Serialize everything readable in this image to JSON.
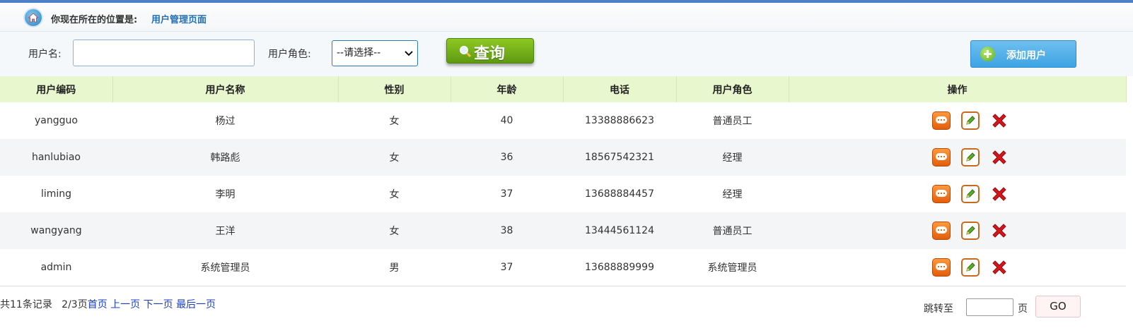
{
  "location": {
    "label": "你现在所在的位置是:",
    "value": "用户管理页面",
    "icon": "home-icon"
  },
  "search": {
    "username_label": "用户名:",
    "username_value": "",
    "role_label": "用户角色:",
    "role_selected": "--请选择--",
    "query_label": "查询",
    "add_label": "添加用户"
  },
  "table": {
    "headers": [
      "用户编码",
      "用户名称",
      "性别",
      "年龄",
      "电话",
      "用户角色",
      "操作"
    ],
    "rows": [
      {
        "code": "yangguo",
        "name": "杨过",
        "gender": "女",
        "age": "40",
        "phone": "13388886623",
        "role": "普通员工"
      },
      {
        "code": "hanlubiao",
        "name": "韩路彪",
        "gender": "女",
        "age": "36",
        "phone": "18567542321",
        "role": "经理"
      },
      {
        "code": "liming",
        "name": "李明",
        "gender": "女",
        "age": "37",
        "phone": "13688884457",
        "role": "经理"
      },
      {
        "code": "wangyang",
        "name": "王洋",
        "gender": "女",
        "age": "38",
        "phone": "13444561124",
        "role": "普通员工"
      },
      {
        "code": "admin",
        "name": "系统管理员",
        "gender": "男",
        "age": "37",
        "phone": "13688889999",
        "role": "系统管理员"
      }
    ],
    "action_icons": [
      "view-icon",
      "edit-icon",
      "delete-icon"
    ]
  },
  "pager": {
    "summary": "共11条记录   2/3页",
    "first": "首页",
    "prev": "上一页",
    "next": "下一页",
    "last": "最后一页",
    "jump_label": "跳转至",
    "jump_value": "",
    "page_unit": "页",
    "go": "GO"
  },
  "colors": {
    "topbar": "#4f7fc6",
    "header_bg": "#e8f7cd",
    "query_btn": "#7ab41b",
    "add_btn": "#4aa8e8",
    "link": "#1a3fc4"
  }
}
